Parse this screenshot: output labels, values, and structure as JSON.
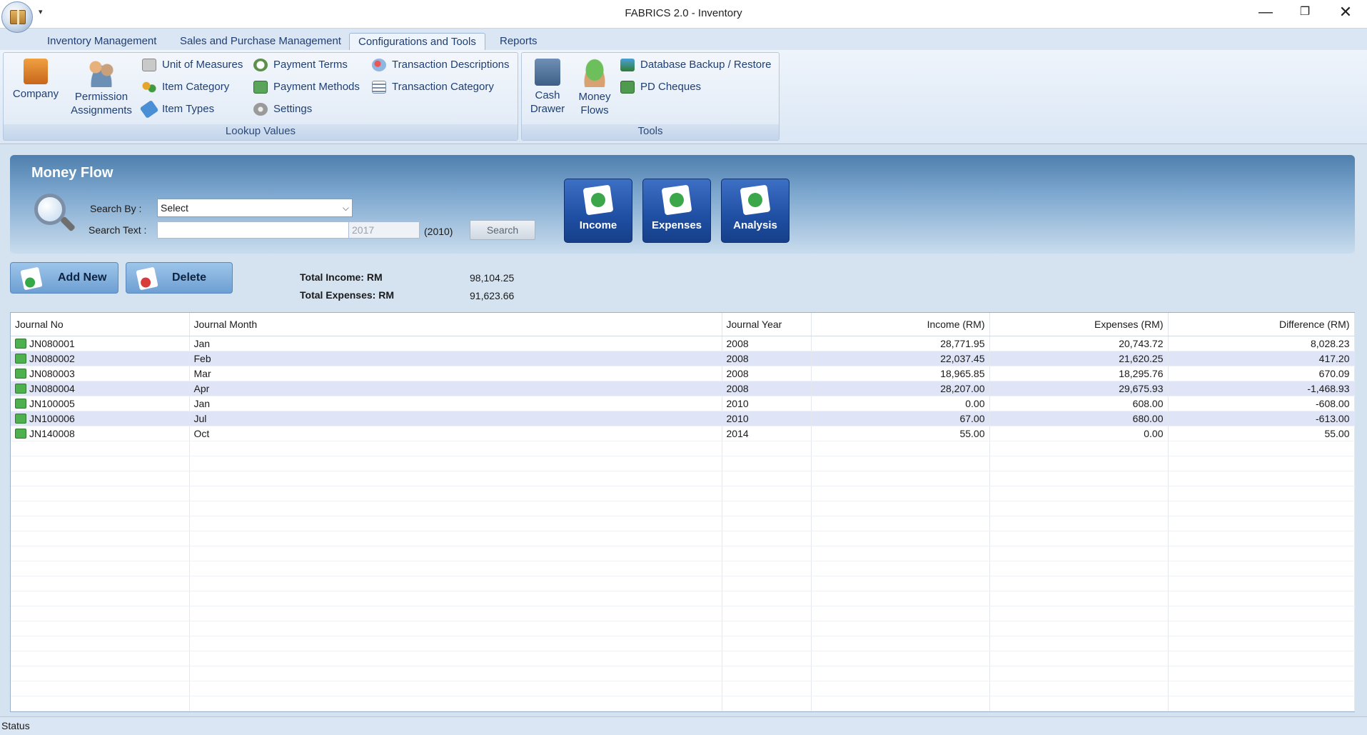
{
  "window": {
    "title": "FABRICS 2.0 - Inventory",
    "minimize": "—",
    "maximize": "❐",
    "close": "✕",
    "quick_access": "▾"
  },
  "ribbon": {
    "tabs": [
      "Inventory Management",
      "Sales and Purchase Management",
      "Configurations and Tools",
      "Reports"
    ],
    "active_tab": "Configurations and Tools",
    "lookup_group": {
      "label": "Lookup Values",
      "company": "Company",
      "permission_line1": "Permission",
      "permission_line2": "Assignments",
      "unit_of_measures": "Unit of Measures",
      "item_category": "Item Category",
      "item_types": "Item Types",
      "payment_terms": "Payment Terms",
      "payment_methods": "Payment Methods",
      "settings": "Settings",
      "transaction_descriptions": "Transaction Descriptions",
      "transaction_category": "Transaction Category"
    },
    "tools_group": {
      "label": "Tools",
      "cash_line1": "Cash",
      "cash_line2": "Drawer",
      "money_line1": "Money",
      "money_line2": "Flows",
      "database_backup": "Database Backup / Restore",
      "pd_cheques": "PD Cheques"
    }
  },
  "panel": {
    "title": "Money Flow",
    "search_by_label": "Search By :",
    "search_by_value": "Select",
    "search_text_label": "Search Text :",
    "search_text_value": "",
    "year_value": "2017",
    "year_hint": "(2010)",
    "search_button": "Search",
    "income_tile": "Income",
    "expenses_tile": "Expenses",
    "analysis_tile": "Analysis"
  },
  "actions": {
    "add_new": "Add New",
    "delete": "Delete"
  },
  "totals": {
    "income_label": "Total Income: RM",
    "income_value": "98,104.25",
    "expenses_label": "Total Expenses: RM",
    "expenses_value": "91,623.66"
  },
  "grid": {
    "columns": [
      "Journal No",
      "Journal Month",
      "Journal Year",
      "Income (RM)",
      "Expenses (RM)",
      "Difference (RM)"
    ],
    "rows": [
      {
        "no": "JN080001",
        "month": "Jan",
        "year": "2008",
        "income": "28,771.95",
        "expenses": "20,743.72",
        "diff": "8,028.23"
      },
      {
        "no": "JN080002",
        "month": "Feb",
        "year": "2008",
        "income": "22,037.45",
        "expenses": "21,620.25",
        "diff": "417.20"
      },
      {
        "no": "JN080003",
        "month": "Mar",
        "year": "2008",
        "income": "18,965.85",
        "expenses": "18,295.76",
        "diff": "670.09"
      },
      {
        "no": "JN080004",
        "month": "Apr",
        "year": "2008",
        "income": "28,207.00",
        "expenses": "29,675.93",
        "diff": "-1,468.93"
      },
      {
        "no": "JN100005",
        "month": "Jan",
        "year": "2010",
        "income": "0.00",
        "expenses": "608.00",
        "diff": "-608.00"
      },
      {
        "no": "JN100006",
        "month": "Jul",
        "year": "2010",
        "income": "67.00",
        "expenses": "680.00",
        "diff": "-613.00"
      },
      {
        "no": "JN140008",
        "month": "Oct",
        "year": "2014",
        "income": "55.00",
        "expenses": "0.00",
        "diff": "55.00"
      }
    ]
  },
  "status": {
    "text": "Status"
  }
}
